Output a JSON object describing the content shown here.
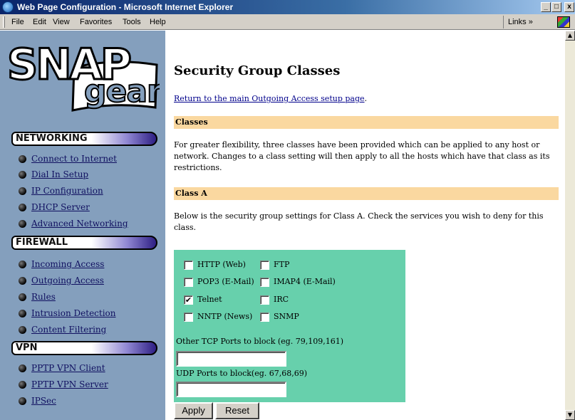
{
  "window": {
    "title": "Web Page Configuration - Microsoft Internet Explorer",
    "min": "_",
    "max": "□",
    "close": "x"
  },
  "menu": {
    "items": [
      "File",
      "Edit",
      "View",
      "Favorites",
      "Tools",
      "Help"
    ],
    "links": "Links »"
  },
  "logo": {
    "top": "SNAP",
    "bottom": "gear"
  },
  "sidebar": {
    "networking": {
      "title": "NETWORKING",
      "items": [
        "Connect to Internet",
        "Dial In Setup",
        "IP Configuration",
        "DHCP Server",
        "Advanced Networking"
      ]
    },
    "firewall": {
      "title": "FIREWALL",
      "items": [
        "Incoming Access",
        "Outgoing Access",
        "Rules",
        "Intrusion Detection",
        "Content Filtering"
      ]
    },
    "vpn": {
      "title": "VPN",
      "items": [
        "PPTP VPN Client",
        "PPTP VPN Server",
        "IPSec"
      ]
    }
  },
  "page": {
    "title": "Security Group Classes",
    "return_link": "Return to the main Outgoing Access setup page",
    "return_period": ".",
    "classes_header": "Classes",
    "classes_text": "For greater flexibility, three classes have been provided which can be applied to any host or network. Changes to a class setting will then apply to all the hosts which have that class as its restrictions.",
    "classa_header": "Class A",
    "classa_text": "Below is the security group settings for Class A. Check the services you wish to deny for this class."
  },
  "services": [
    {
      "label": "HTTP (Web)",
      "checked": false
    },
    {
      "label": "FTP",
      "checked": false
    },
    {
      "label": "POP3 (E-Mail)",
      "checked": false
    },
    {
      "label": "IMAP4 (E-Mail)",
      "checked": false
    },
    {
      "label": "Telnet",
      "checked": true
    },
    {
      "label": "IRC",
      "checked": false
    },
    {
      "label": "NNTP (News)",
      "checked": false
    },
    {
      "label": "SNMP",
      "checked": false
    }
  ],
  "tcp": {
    "label": "Other TCP Ports to block (eg. 79,109,161)",
    "value": ""
  },
  "udp": {
    "label": "UDP Ports to block(eg. 67,68,69)",
    "value": ""
  },
  "buttons": {
    "apply": "Apply",
    "reset": "Reset"
  },
  "colors": {
    "sidebar": "#849fbd",
    "section_bar": "#fad8a0",
    "form_bg": "#67d0ac"
  }
}
